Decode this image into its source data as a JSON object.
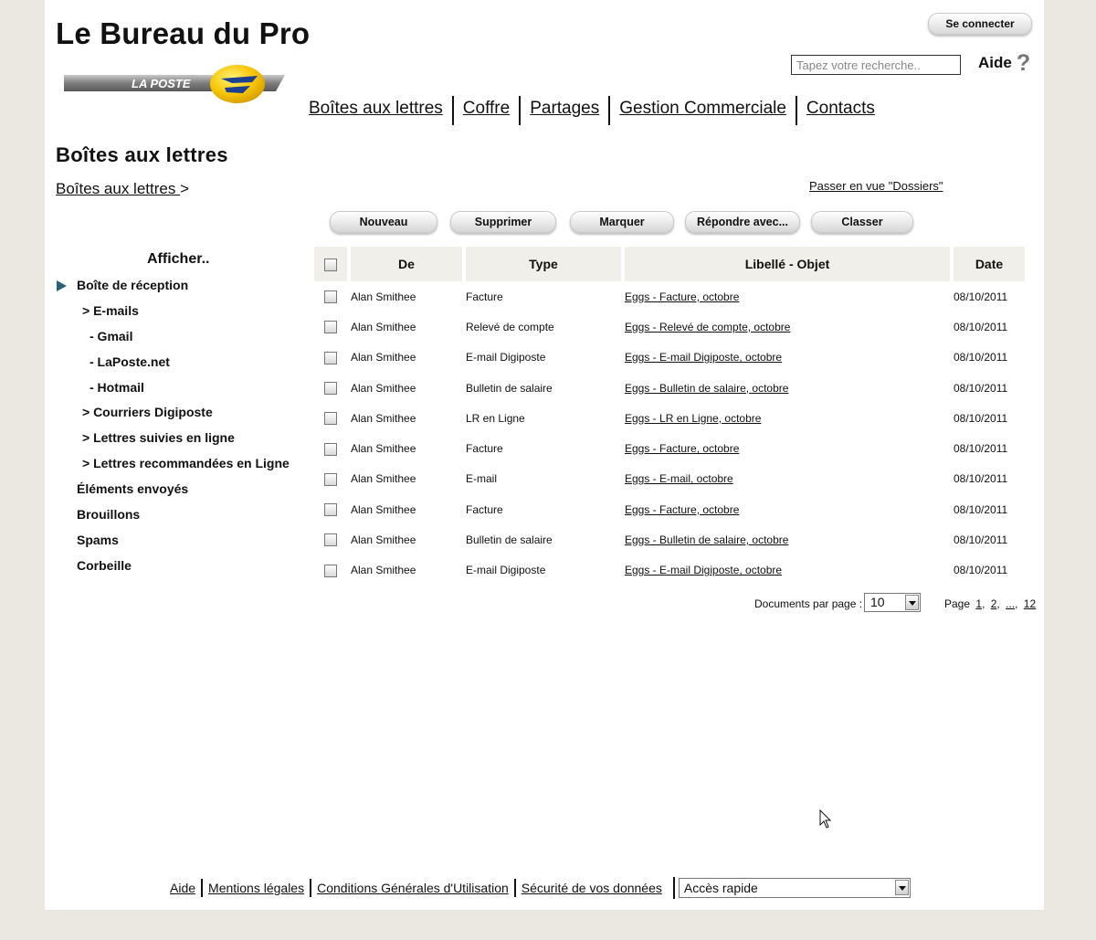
{
  "header": {
    "app_title": "Le Bureau du Pro",
    "logo_text": "LA POSTE",
    "login_label": "Se connecter",
    "search_placeholder": "Tapez votre recherche..",
    "help_label": "Aide",
    "help_icon": "?"
  },
  "nav": [
    {
      "label": "Boîtes aux lettres"
    },
    {
      "label": "Coffre"
    },
    {
      "label": "Partages"
    },
    {
      "label": "Gestion Commerciale"
    },
    {
      "label": "Contacts"
    }
  ],
  "page": {
    "title": "Boîtes aux lettres",
    "breadcrumb_link": "Boîtes aux lettres ",
    "breadcrumb_sep": ">",
    "folders_view_link": "Passer en vue \"Dossiers\""
  },
  "toolbar": {
    "new": "Nouveau",
    "delete": "Supprimer",
    "mark": "Marquer",
    "reply_with": "Répondre avec...",
    "file": "Classer"
  },
  "sidebar": {
    "heading": "Afficher..",
    "items": [
      {
        "label": "Boîte de réception",
        "selected": true
      },
      {
        "label": "> E-mails"
      },
      {
        "label": "- Gmail"
      },
      {
        "label": "- LaPoste.net"
      },
      {
        "label": "- Hotmail"
      },
      {
        "label": "> Courriers Digiposte"
      },
      {
        "label": "> Lettres suivies en ligne"
      },
      {
        "label": "> Lettres recommandées en Ligne"
      },
      {
        "label": "Éléments envoyés"
      },
      {
        "label": "Brouillons"
      },
      {
        "label": "Spams"
      },
      {
        "label": "Corbeille"
      }
    ]
  },
  "table": {
    "columns": [
      "De",
      "Type",
      "Libellé - Objet",
      "Date"
    ],
    "rows": [
      {
        "from": "Alan Smithee",
        "type": "Facture",
        "subject": "Eggs - Facture, octobre",
        "date": "08/10/2011"
      },
      {
        "from": "Alan Smithee",
        "type": "Relevé de compte",
        "subject": "Eggs - Relevé de compte, octobre",
        "date": "08/10/2011"
      },
      {
        "from": "Alan Smithee",
        "type": "E-mail Digiposte",
        "subject": "Eggs - E-mail Digiposte, octobre",
        "date": "08/10/2011"
      },
      {
        "from": "Alan Smithee",
        "type": "Bulletin de salaire",
        "subject": "Eggs - Bulletin de salaire, octobre",
        "date": "08/10/2011"
      },
      {
        "from": "Alan Smithee",
        "type": "LR en Ligne",
        "subject": "Eggs - LR en Ligne, octobre",
        "date": "08/10/2011"
      },
      {
        "from": "Alan Smithee",
        "type": "Facture",
        "subject": "Eggs - Facture, octobre",
        "date": "08/10/2011"
      },
      {
        "from": "Alan Smithee",
        "type": "E-mail",
        "subject": "Eggs - E-mail, octobre",
        "date": "08/10/2011"
      },
      {
        "from": "Alan Smithee",
        "type": "Facture",
        "subject": "Eggs - Facture, octobre",
        "date": "08/10/2011"
      },
      {
        "from": "Alan Smithee",
        "type": "Bulletin de salaire",
        "subject": "Eggs - Bulletin de salaire, octobre",
        "date": "08/10/2011"
      },
      {
        "from": "Alan Smithee",
        "type": "E-mail Digiposte",
        "subject": "Eggs - E-mail Digiposte, octobre",
        "date": "08/10/2011"
      }
    ]
  },
  "pagination": {
    "per_page_label": "Documents par page :",
    "per_page_value": "10",
    "page_label": "Page",
    "pages": [
      "1",
      "2",
      "...",
      "12"
    ]
  },
  "footer": {
    "links": [
      "Aide",
      "Mentions légales",
      "Conditions Générales d'Utilisation",
      "Sécurité de vos données"
    ],
    "quick_access": "Accès rapide"
  },
  "colors": {
    "page_background": "#ebe8e1",
    "header_cell": "#f0efe9",
    "selected_arrow": "#2a6178",
    "logo_yellow": "#f7c400"
  }
}
